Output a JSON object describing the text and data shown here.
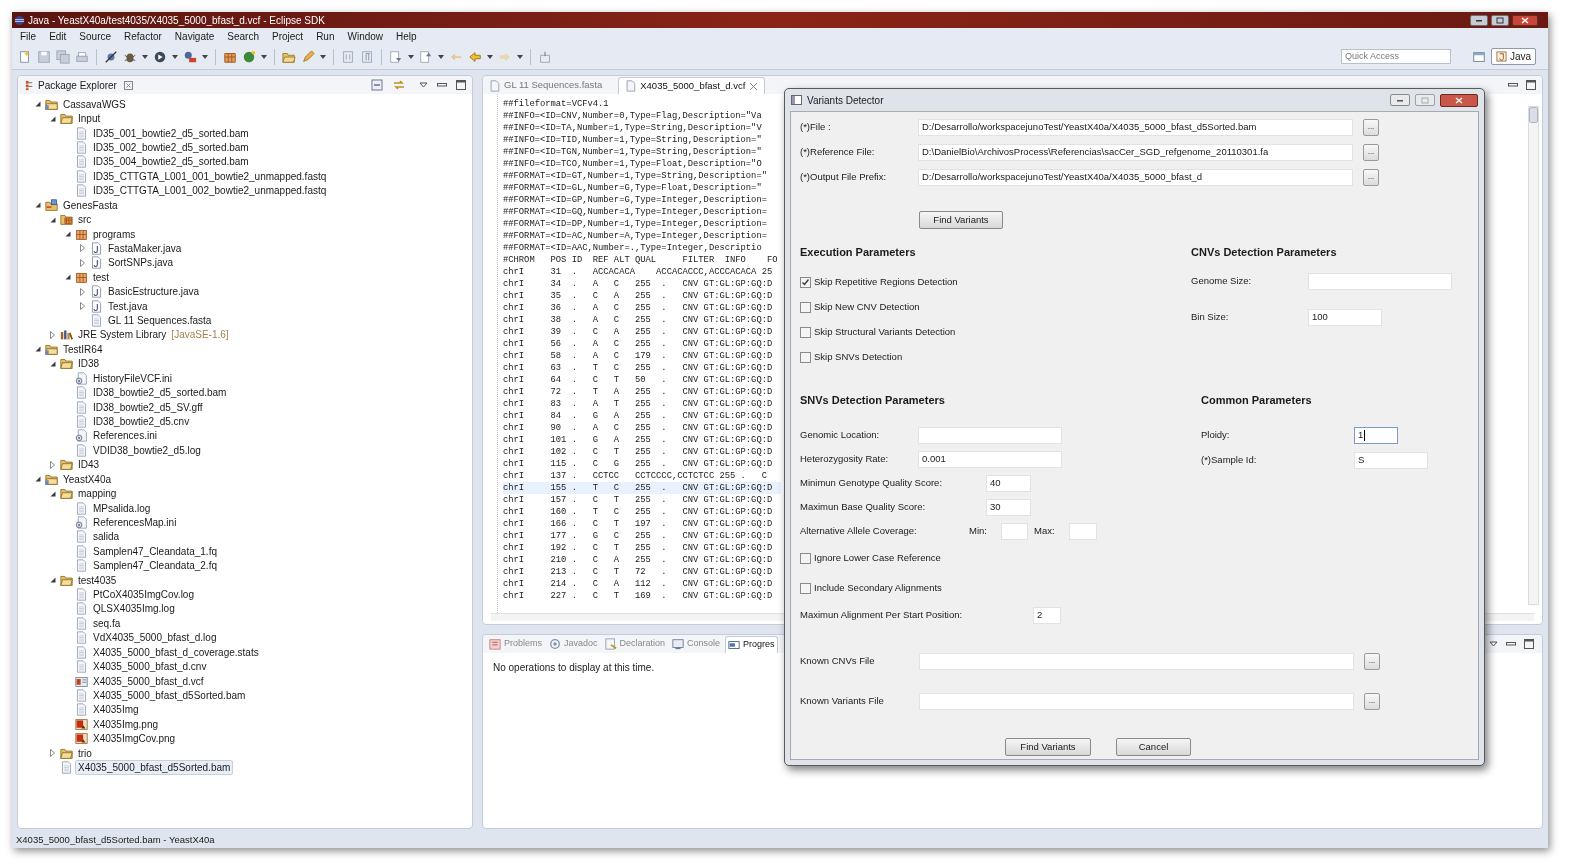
{
  "window": {
    "title": "Java - YeastX40a/test4035/X4035_5000_bfast_d.vcf - Eclipse SDK"
  },
  "menu": [
    "File",
    "Edit",
    "Source",
    "Refactor",
    "Navigate",
    "Search",
    "Project",
    "Run",
    "Window",
    "Help"
  ],
  "quick_access": {
    "placeholder": "Quick Access"
  },
  "perspective": {
    "label": "Java",
    "selected": true
  },
  "package_explorer": {
    "title": "Package Explorer",
    "tree": [
      {
        "label": "CassavaWGS",
        "kind": "project",
        "expanded": true,
        "selected": false,
        "children": [
          {
            "label": "Input",
            "kind": "folder",
            "expanded": true,
            "selected": false,
            "children": [
              {
                "label": "ID35_001_bowtie2_d5_sorted.bam",
                "kind": "file",
                "selected": false
              },
              {
                "label": "ID35_002_bowtie2_d5_sorted.bam",
                "kind": "file",
                "selected": false
              },
              {
                "label": "ID35_004_bowtie2_d5_sorted.bam",
                "kind": "file",
                "selected": false
              },
              {
                "label": "ID35_CTTGTA_L001_001_bowtie2_unmapped.fastq",
                "kind": "file",
                "selected": false
              },
              {
                "label": "ID35_CTTGTA_L001_002_bowtie2_unmapped.fastq",
                "kind": "file",
                "selected": false
              }
            ]
          }
        ]
      },
      {
        "label": "GenesFasta",
        "kind": "java_project",
        "expanded": true,
        "selected": false,
        "children": [
          {
            "label": "src",
            "kind": "source_folder",
            "expanded": true,
            "selected": false,
            "children": [
              {
                "label": "programs",
                "kind": "package",
                "expanded": true,
                "selected": false,
                "children": [
                  {
                    "label": "FastaMaker.java",
                    "kind": "java",
                    "expanded": false,
                    "selected": false
                  },
                  {
                    "label": "SortSNPs.java",
                    "kind": "java",
                    "expanded": false,
                    "selected": false
                  }
                ]
              },
              {
                "label": "test",
                "kind": "package",
                "expanded": true,
                "selected": false,
                "children": [
                  {
                    "label": "BasicEstructure.java",
                    "kind": "java",
                    "expanded": false,
                    "selected": false
                  },
                  {
                    "label": "Test.java",
                    "kind": "java",
                    "expanded": false,
                    "selected": false
                  },
                  {
                    "label": "GL 11 Sequences.fasta",
                    "kind": "file",
                    "selected": false
                  }
                ]
              }
            ]
          },
          {
            "label": "JRE System Library",
            "decoration": "[JavaSE-1.6]",
            "kind": "library",
            "expanded": false,
            "selected": false
          }
        ]
      },
      {
        "label": "TestIR64",
        "kind": "project",
        "expanded": true,
        "selected": false,
        "children": [
          {
            "label": "ID38",
            "kind": "folder",
            "expanded": true,
            "selected": false,
            "children": [
              {
                "label": "HistoryFileVCF.ini",
                "kind": "settings",
                "selected": false
              },
              {
                "label": "ID38_bowtie2_d5_sorted.bam",
                "kind": "file",
                "selected": false
              },
              {
                "label": "ID38_bowtie2_d5_SV.gff",
                "kind": "file",
                "selected": false
              },
              {
                "label": "ID38_bowtie2_d5.cnv",
                "kind": "file",
                "selected": false
              },
              {
                "label": "References.ini",
                "kind": "settings",
                "selected": false
              },
              {
                "label": "VDID38_bowtie2_d5.log",
                "kind": "file",
                "selected": false
              }
            ]
          },
          {
            "label": "ID43",
            "kind": "folder",
            "expanded": false,
            "selected": false
          }
        ]
      },
      {
        "label": "YeastX40a",
        "kind": "project",
        "expanded": true,
        "selected": false,
        "children": [
          {
            "label": "mapping",
            "kind": "folder",
            "expanded": true,
            "selected": false,
            "children": [
              {
                "label": "MPsalida.log",
                "kind": "file",
                "selected": false
              },
              {
                "label": "ReferencesMap.ini",
                "kind": "settings",
                "selected": false
              },
              {
                "label": "salida",
                "kind": "file",
                "selected": false
              },
              {
                "label": "Samplen47_Cleandata_1.fq",
                "kind": "file",
                "selected": false
              },
              {
                "label": "Samplen47_Cleandata_2.fq",
                "kind": "file",
                "selected": false
              }
            ]
          },
          {
            "label": "test4035",
            "kind": "folder",
            "expanded": true,
            "selected": false,
            "children": [
              {
                "label": "PtCoX4035ImgCov.log",
                "kind": "file",
                "selected": false
              },
              {
                "label": "QLSX4035Img.log",
                "kind": "file",
                "selected": false
              },
              {
                "label": "seq.fa",
                "kind": "file",
                "selected": false
              },
              {
                "label": "VdX4035_5000_bfast_d.log",
                "kind": "file",
                "selected": false
              },
              {
                "label": "X4035_5000_bfast_d_coverage.stats",
                "kind": "file",
                "selected": false
              },
              {
                "label": "X4035_5000_bfast_d.cnv",
                "kind": "file",
                "selected": false
              },
              {
                "label": "X4035_5000_bfast_d.vcf",
                "kind": "vcf",
                "selected": false
              },
              {
                "label": "X4035_5000_bfast_d5Sorted.bam",
                "kind": "file",
                "selected": false
              },
              {
                "label": "X4035Img",
                "kind": "file",
                "selected": false
              },
              {
                "label": "X4035Img.png",
                "kind": "image",
                "selected": false
              },
              {
                "label": "X4035ImgCov.png",
                "kind": "image",
                "selected": false
              }
            ]
          },
          {
            "label": "trio",
            "kind": "folder",
            "expanded": false,
            "selected": false
          },
          {
            "label": "X4035_5000_bfast_d5Sorted.bam",
            "kind": "file",
            "selected": true
          }
        ]
      }
    ]
  },
  "editor": {
    "tabs": [
      {
        "label": "GL 11 Sequences.fasta",
        "selected": false
      },
      {
        "label": "X4035_5000_bfast_d.vcf",
        "selected": true
      }
    ],
    "lines": [
      {
        "text": "##fileformat=VCFv4.1",
        "current": false
      },
      {
        "text": "##INFO=<ID=CNV,Number=0,Type=Flag,Description=\"Va",
        "current": false
      },
      {
        "text": "##INFO=<ID=TA,Number=1,Type=String,Description=\"V",
        "current": false
      },
      {
        "text": "##INFO=<ID=TID,Number=1,Type=String,Description=\"",
        "current": false
      },
      {
        "text": "##INFO=<ID=TGN,Number=1,Type=String,Description=\"",
        "current": false
      },
      {
        "text": "##INFO=<ID=TCO,Number=1,Type=Float,Description=\"O",
        "current": false
      },
      {
        "text": "##FORMAT=<ID=GT,Number=1,Type=String,Description=\"",
        "current": false
      },
      {
        "text": "##FORMAT=<ID=GL,Number=G,Type=Float,Description=\"",
        "current": false
      },
      {
        "text": "##FORMAT=<ID=GP,Number=G,Type=Integer,Description=",
        "current": false
      },
      {
        "text": "##FORMAT=<ID=GQ,Number=1,Type=Integer,Description=",
        "current": false
      },
      {
        "text": "##FORMAT=<ID=DP,Number=1,Type=Integer,Description=",
        "current": false
      },
      {
        "text": "##FORMAT=<ID=AC,Number=A,Type=Integer,Description=",
        "current": false
      },
      {
        "text": "##FORMAT=<ID=AAC,Number=.,Type=Integer,Descriptio",
        "current": false
      },
      {
        "text": "#CHROM   POS ID  REF ALT QUAL     FILTER  INFO    FO",
        "current": false
      },
      {
        "text": "chrI     31  .   ACCACACA    ACCACACCC,ACCCACACA 25",
        "current": false
      },
      {
        "text": "chrI     34  .   A   C   255  .   CNV GT:GL:GP:GQ:D",
        "current": false
      },
      {
        "text": "chrI     35  .   C   A   255  .   CNV GT:GL:GP:GQ:D",
        "current": false
      },
      {
        "text": "chrI     36  .   A   C   255  .   CNV GT:GL:GP:GQ:D",
        "current": false
      },
      {
        "text": "chrI     38  .   A   C   255  .   CNV GT:GL:GP:GQ:D",
        "current": false
      },
      {
        "text": "chrI     39  .   C   A   255  .   CNV GT:GL:GP:GQ:D",
        "current": false
      },
      {
        "text": "chrI     56  .   A   C   255  .   CNV GT:GL:GP:GQ:D",
        "current": false
      },
      {
        "text": "chrI     58  .   A   C   179  .   CNV GT:GL:GP:GQ:D",
        "current": false
      },
      {
        "text": "chrI     63  .   T   C   255  .   CNV GT:GL:GP:GQ:D",
        "current": false
      },
      {
        "text": "chrI     64  .   C   T   50   .   CNV GT:GL:GP:GQ:D",
        "current": false
      },
      {
        "text": "chrI     72  .   T   A   255  .   CNV GT:GL:GP:GQ:D",
        "current": false
      },
      {
        "text": "chrI     83  .   A   T   255  .   CNV GT:GL:GP:GQ:D",
        "current": false
      },
      {
        "text": "chrI     84  .   G   A   255  .   CNV GT:GL:GP:GQ:D",
        "current": false
      },
      {
        "text": "chrI     90  .   A   C   255  .   CNV GT:GL:GP:GQ:D",
        "current": false
      },
      {
        "text": "chrI     101 .   G   A   255  .   CNV GT:GL:GP:GQ:D",
        "current": false
      },
      {
        "text": "chrI     102 .   C   T   255  .   CNV GT:GL:GP:GQ:D",
        "current": false
      },
      {
        "text": "chrI     115 .   C   G   255  .   CNV GT:GL:GP:GQ:D",
        "current": false
      },
      {
        "text": "chrI     137 .   CCTCC   CCTCCCC,CCTCTCC 255 .   C",
        "current": false
      },
      {
        "text": "chrI     155 .   T   C   255  .   CNV GT:GL:GP:GQ:D",
        "current": true
      },
      {
        "text": "chrI     157 .   C   T   255  .   CNV GT:GL:GP:GQ:D",
        "current": false
      },
      {
        "text": "chrI     160 .   T   C   255  .   CNV GT:GL:GP:GQ:D",
        "current": false
      },
      {
        "text": "chrI     166 .   C   T   197  .   CNV GT:GL:GP:GQ:D",
        "current": false
      },
      {
        "text": "chrI     177 .   G   C   255  .   CNV GT:GL:GP:GQ:D",
        "current": false
      },
      {
        "text": "chrI     192 .   C   T   255  .   CNV GT:GL:GP:GQ:D",
        "current": false
      },
      {
        "text": "chrI     210 .   C   A   255  .   CNV GT:GL:GP:GQ:D",
        "current": false
      },
      {
        "text": "chrI     213 .   C   T   72   .   CNV GT:GL:GP:GQ:D",
        "current": false
      },
      {
        "text": "chrI     214 .   C   A   112  .   CNV GT:GL:GP:GQ:D",
        "current": false
      },
      {
        "text": "chrI     227 .   C   T   169  .   CNV GT:GL:GP:GQ:D",
        "current": false
      }
    ]
  },
  "bottom_panel": {
    "tabs": [
      {
        "label": "Problems",
        "selected": false
      },
      {
        "label": "Javadoc",
        "selected": false
      },
      {
        "label": "Declaration",
        "selected": false
      },
      {
        "label": "Console",
        "selected": false
      },
      {
        "label": "Progres",
        "selected": true
      }
    ],
    "message": "No operations to display at this time."
  },
  "status_bar": "X4035_5000_bfast_d5Sorted.bam - YeastX40a",
  "dialog": {
    "title": "Variants Detector",
    "file_fields": [
      {
        "label": "(*)File :",
        "value": "D:/Desarrollo/workspacejunoTest/YeastX40a/X4035_5000_bfast_d5Sorted.bam",
        "browse": "..."
      },
      {
        "label": "(*)Reference File:",
        "value": "D:\\DanielBio\\ArchivosProcess\\Referencias\\sacCer_SGD_refgenome_20110301.fa",
        "browse": "..."
      },
      {
        "label": "(*)Output File Prefix:",
        "value": "D:/Desarrollo/workspacejunoTest/YeastX40a/X4035_5000_bfast_d",
        "browse": "..."
      }
    ],
    "find_button": "Find Variants",
    "execution": {
      "heading": "Execution Parameters",
      "options": [
        {
          "label": "Skip Repetitive Regions Detection",
          "checked": true
        },
        {
          "label": "Skip New CNV Detection",
          "checked": false
        },
        {
          "label": "Skip Structural Variants Detection",
          "checked": false
        },
        {
          "label": "Skip SNVs Detection",
          "checked": false
        }
      ]
    },
    "cnv": {
      "heading": "CNVs Detection Parameters",
      "fields": [
        {
          "label": "Genome Size:",
          "kind": "wide"
        },
        {
          "label": "Bin Size:",
          "value": "100",
          "kind": "medium"
        }
      ]
    },
    "snv": {
      "heading": "SNVs Detection Parameters",
      "rows": [
        {
          "kind": "field",
          "label": "Genomic Location:"
        },
        {
          "kind": "field",
          "label": "Heterozygosity Rate:",
          "value": "0.001"
        },
        {
          "kind": "short",
          "label": "Minimun Genotype Quality Score:",
          "value": "40"
        },
        {
          "kind": "short",
          "label": "Maximun Base Quality Score:",
          "value": "30"
        },
        {
          "kind": "range",
          "label": "Alternative  Allele Coverage:",
          "min_label": "Min:",
          "max_label": "Max:"
        },
        {
          "kind": "check",
          "label": "Ignore Lower Case Reference",
          "checked": false
        },
        {
          "kind": "check",
          "label": "Include Secondary Alignments",
          "checked": false
        },
        {
          "kind": "long_short",
          "label": "Maximun Alignment Per Start Position:",
          "value": "2"
        }
      ]
    },
    "common": {
      "heading": "Common Parameters",
      "fields": [
        {
          "label": "Ploidy:",
          "value": "1",
          "kind": "small",
          "focused": true
        },
        {
          "label": "(*)Sample Id:",
          "value": "S",
          "kind": "medium",
          "focused": false
        }
      ]
    },
    "known_files": [
      {
        "label": "Known CNVs File",
        "browse": "..."
      },
      {
        "label": "Known Variants File",
        "browse": "..."
      }
    ],
    "buttons": [
      "Find Variants",
      "Cancel"
    ]
  }
}
